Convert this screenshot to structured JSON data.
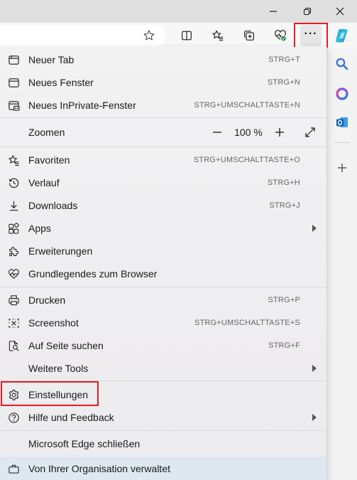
{
  "toolbar": {
    "favorite_star": "star-icon",
    "split_screen": "split-screen-icon",
    "favorites": "favorites-icon",
    "collections": "collections-icon",
    "browser_essentials": "browser-essentials-icon",
    "settings_more": "···"
  },
  "menu": {
    "new_tab": {
      "label": "Neuer Tab",
      "shortcut": "STRG+T"
    },
    "new_window": {
      "label": "Neues Fenster",
      "shortcut": "STRG+N"
    },
    "new_inprivate": {
      "label": "Neues InPrivate-Fenster",
      "shortcut": "STRG+UMSCHALTTASTE+N"
    },
    "zoom": {
      "label": "Zoomen",
      "value": "100 %"
    },
    "favorites": {
      "label": "Favoriten",
      "shortcut": "STRG+UMSCHALTTASTE+O"
    },
    "history": {
      "label": "Verlauf",
      "shortcut": "STRG+H"
    },
    "downloads": {
      "label": "Downloads",
      "shortcut": "STRG+J"
    },
    "apps": {
      "label": "Apps"
    },
    "extensions": {
      "label": "Erweiterungen"
    },
    "essentials": {
      "label": "Grundlegendes zum Browser"
    },
    "print": {
      "label": "Drucken",
      "shortcut": "STRG+P"
    },
    "screenshot": {
      "label": "Screenshot",
      "shortcut": "STRG+UMSCHALTTASTE+S"
    },
    "find": {
      "label": "Auf Seite suchen",
      "shortcut": "STRG+F"
    },
    "more_tools": {
      "label": "Weitere Tools"
    },
    "settings": {
      "label": "Einstellungen"
    },
    "help": {
      "label": "Hilfe und Feedback"
    },
    "close_edge": {
      "label": "Microsoft Edge schließen"
    },
    "managed": {
      "label": "Von Ihrer Organisation verwaltet"
    }
  },
  "colors": {
    "highlight": "#e21d24",
    "managed_bg": "#dde8f0",
    "essentials_badge": "#0f8a3a"
  }
}
